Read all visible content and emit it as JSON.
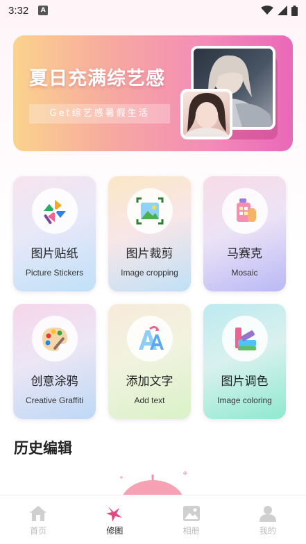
{
  "status_bar": {
    "time": "3:32",
    "notification_glyph": "A"
  },
  "banner": {
    "title": "夏日充满综艺感",
    "subtitle": "Get综艺感暑假生活"
  },
  "tools": [
    {
      "cn": "图片贴纸",
      "en": "Picture Stickers",
      "icon": "pinwheel-icon"
    },
    {
      "cn": "图片裁剪",
      "en": "Image cropping",
      "icon": "crop-image-icon"
    },
    {
      "cn": "马赛克",
      "en": "Mosaic",
      "icon": "mosaic-brush-icon"
    },
    {
      "cn": "创意涂鸦",
      "en": "Creative Graffiti",
      "icon": "paint-palette-icon"
    },
    {
      "cn": "添加文字",
      "en": "Add text",
      "icon": "text-a-icon"
    },
    {
      "cn": "图片调色",
      "en": "Image coloring",
      "icon": "color-adjust-icon"
    }
  ],
  "history": {
    "title": "历史编辑"
  },
  "nav": [
    {
      "label": "首页",
      "icon": "home-icon",
      "active": false
    },
    {
      "label": "修图",
      "icon": "edit-star-icon",
      "active": true
    },
    {
      "label": "相册",
      "icon": "album-icon",
      "active": false
    },
    {
      "label": "我的",
      "icon": "profile-icon",
      "active": false
    }
  ],
  "colors": {
    "accent": "#e8467e",
    "inactive": "#c8c8c8"
  }
}
